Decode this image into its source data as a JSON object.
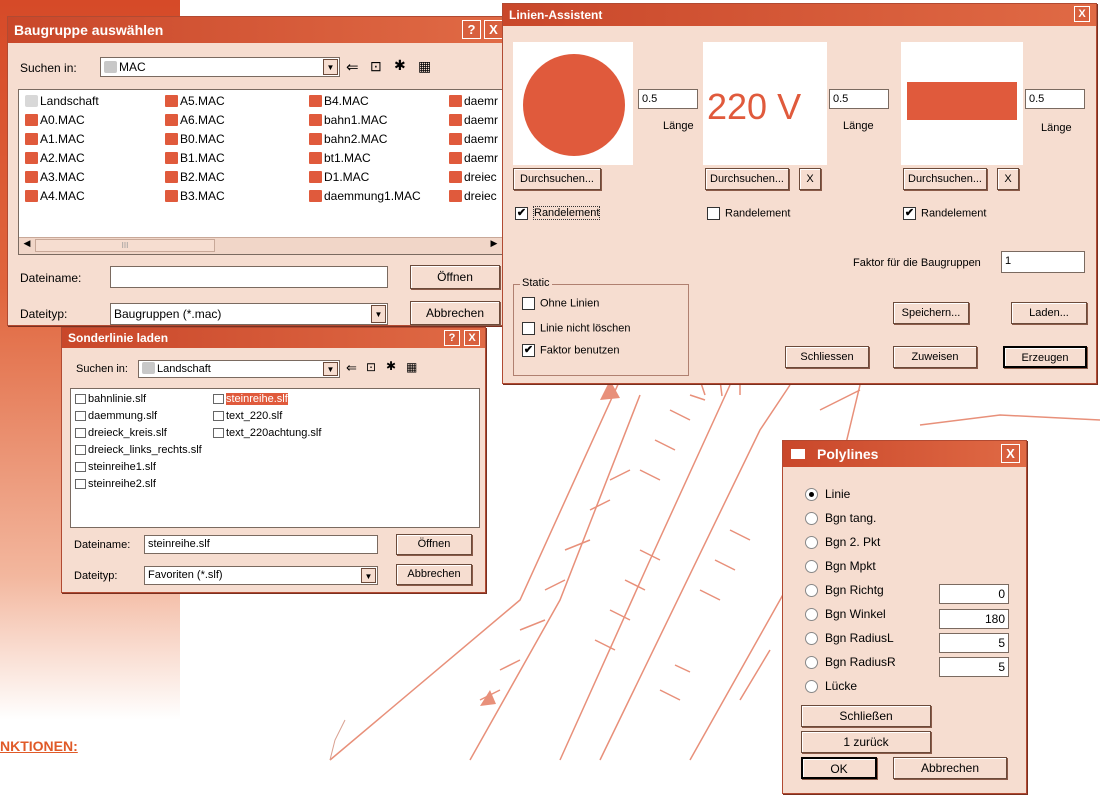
{
  "baugruppe": {
    "title": "Baugruppe auswählen",
    "help": "?",
    "close": "X",
    "lookin_label": "Suchen in:",
    "lookin_value": "MAC",
    "files": [
      "Landschaft",
      "A0.MAC",
      "A1.MAC",
      "A2.MAC",
      "A3.MAC",
      "A4.MAC",
      "A5.MAC",
      "A6.MAC",
      "B0.MAC",
      "B1.MAC",
      "B2.MAC",
      "B3.MAC",
      "B4.MAC",
      "bahn1.MAC",
      "bahn2.MAC",
      "bt1.MAC",
      "D1.MAC",
      "daemmung1.MAC",
      "daemr",
      "daemr",
      "daemr",
      "daemr",
      "dreiec",
      "dreiec"
    ],
    "filename_label": "Dateiname:",
    "filename_value": "",
    "filetype_label": "Dateityp:",
    "filetype_value": "Baugruppen (*.mac)",
    "open_label": "Öffnen",
    "cancel_label": "Abbrechen",
    "scroll_mark": "III"
  },
  "sonderlinie": {
    "title": "Sonderlinie laden",
    "help": "?",
    "close": "X",
    "lookin_label": "Suchen in:",
    "lookin_value": "Landschaft",
    "files": [
      "bahnlinie.slf",
      "daemmung.slf",
      "dreieck_kreis.slf",
      "dreieck_links_rechts.slf",
      "steinreihe1.slf",
      "steinreihe2.slf",
      "steinreihe.slf",
      "text_220.slf",
      "text_220achtung.slf"
    ],
    "filename_label": "Dateiname:",
    "filename_value": "steinreihe.slf",
    "filetype_label": "Dateityp:",
    "filetype_value": "Favoriten (*.slf)",
    "open_label": "Öffnen",
    "cancel_label": "Abbrechen"
  },
  "assistent": {
    "title": "Linien-Assistent",
    "close": "X",
    "preview_text": "220 V",
    "laenge_1": "0.5",
    "laenge_2": "0.5",
    "laenge_3": "0.5",
    "laenge_label": "Länge",
    "browse_label": "Durchsuchen...",
    "x_label": "X",
    "rand_label": "Randelement",
    "rand_1": true,
    "rand_2": false,
    "rand_3": true,
    "faktor_label": "Faktor für die Baugruppen",
    "faktor_value": "1",
    "static_label": "Static",
    "ohne_linien": "Ohne Linien",
    "nicht_loeschen": "Linie nicht löschen",
    "faktor_benutzen": "Faktor benutzen",
    "save_label": "Speichern...",
    "load_label": "Laden...",
    "close_btn": "Schliessen",
    "assign_label": "Zuweisen",
    "create_label": "Erzeugen",
    "check_mark": "✔"
  },
  "polylines": {
    "title": "Polylines",
    "close": "X",
    "options": [
      "Linie",
      "Bgn tang.",
      "Bgn 2. Pkt",
      "Bgn Mpkt",
      "Bgn Richtg",
      "Bgn Winkel",
      "Bgn RadiusL",
      "Bgn RadiusR",
      "Lücke"
    ],
    "richtg_value": "0",
    "winkel_value": "180",
    "radiusl_value": "5",
    "radiusr_value": "5",
    "close_label": "Schließen",
    "back_label": "1 zurück",
    "ok_label": "OK",
    "cancel_label": "Abbrechen"
  },
  "footer_text": "NKTIONEN:",
  "colors": {
    "accent": "#e05a3c",
    "window_bg": "#f6ddd0",
    "title_bar": "#c9472a"
  }
}
